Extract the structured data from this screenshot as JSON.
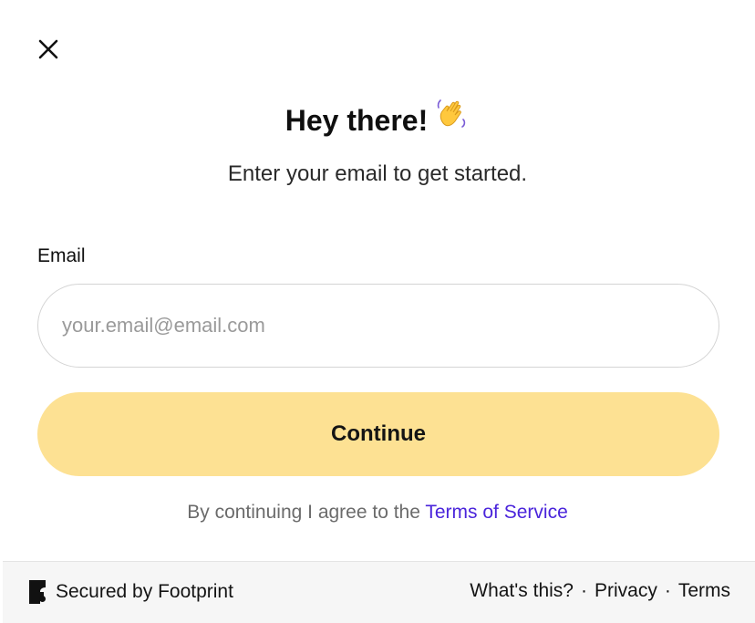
{
  "dialog": {
    "close_icon": "close-icon",
    "title": "Hey there!",
    "title_emoji_icon": "waving-hand-icon",
    "subtitle": "Enter your email to get started."
  },
  "form": {
    "email_label": "Email",
    "email_placeholder": "your.email@email.com",
    "email_value": "",
    "continue_label": "Continue"
  },
  "legal": {
    "prefix": "By continuing I agree to the ",
    "terms_link": "Terms of Service"
  },
  "footer": {
    "brand_icon": "footprint-logo-icon",
    "brand_label": "Secured by Footprint",
    "links": [
      "What's this?",
      "Privacy",
      "Terms"
    ],
    "separator": "·"
  },
  "colors": {
    "button_bg": "#fde193",
    "link": "#4a24db",
    "footer_bg": "#f6f6f6",
    "input_border": "#d4d4d4"
  }
}
